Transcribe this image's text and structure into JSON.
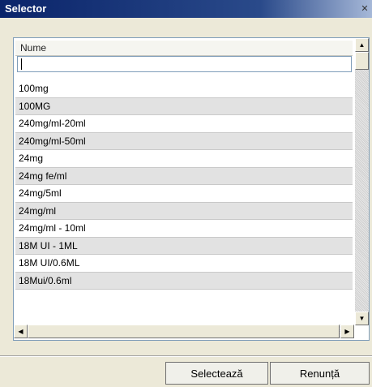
{
  "window": {
    "title": "Selector",
    "close_glyph": "✕"
  },
  "grid": {
    "column_header": "Nume",
    "filter_value": "",
    "rows": [
      "100mg",
      "100MG",
      "240mg/ml-20ml",
      "240mg/ml-50ml",
      "24mg",
      "24mg fe/ml",
      "24mg/5ml",
      "24mg/ml",
      "24mg/ml - 10ml",
      "18M UI - 1ML",
      "18M UI/0.6ML",
      "18Mui/0.6ml"
    ]
  },
  "buttons": {
    "select": "Selectează",
    "cancel": "Renunță"
  },
  "icons": {
    "up": "scroll-up-arrow-icon",
    "down": "scroll-down-arrow-icon",
    "left": "scroll-left-arrow-icon",
    "right": "scroll-right-arrow-icon"
  }
}
